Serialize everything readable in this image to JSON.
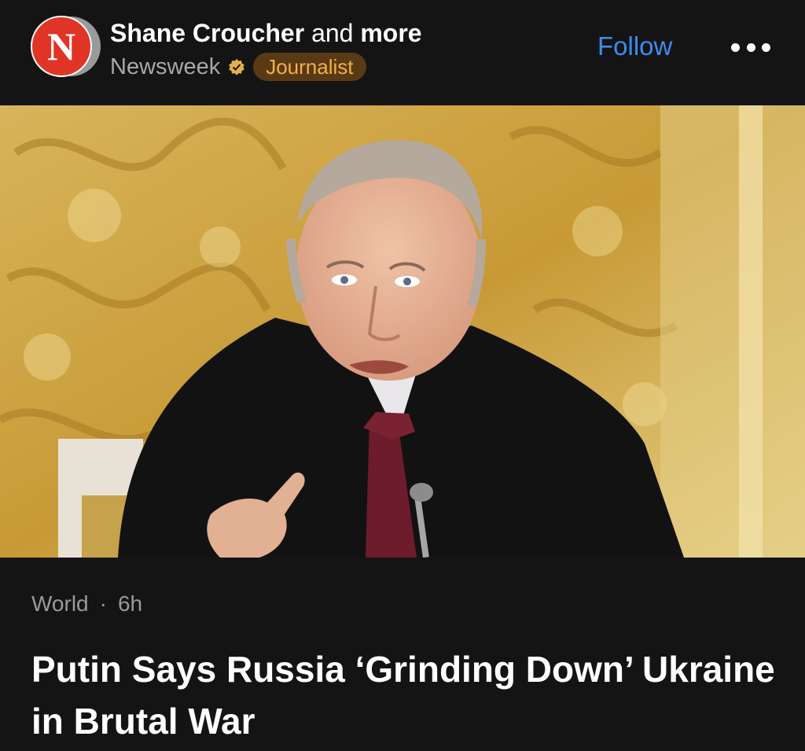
{
  "post_header": {
    "publisher_logo": "newsweek-n-logo",
    "author_name": "Shane Croucher",
    "author_joiner": "and",
    "author_more": "more",
    "publisher_name": "Newsweek",
    "verified_icon": "verified-badge-icon",
    "role_badge": "Journalist",
    "follow_label": "Follow",
    "more_icon": "more-options-icon"
  },
  "hero_image": {
    "description_icon": "article-photo"
  },
  "article": {
    "section": "World",
    "separator": "·",
    "age": "6h",
    "headline": "Putin Says Russia ‘Grinding Down’ Ukraine in Brutal War"
  },
  "colors": {
    "background": "#141414",
    "follow": "#3d8bf5",
    "badge_bg": "#5a3a14",
    "badge_text": "#f0b04a",
    "logo_red": "#e03526"
  }
}
